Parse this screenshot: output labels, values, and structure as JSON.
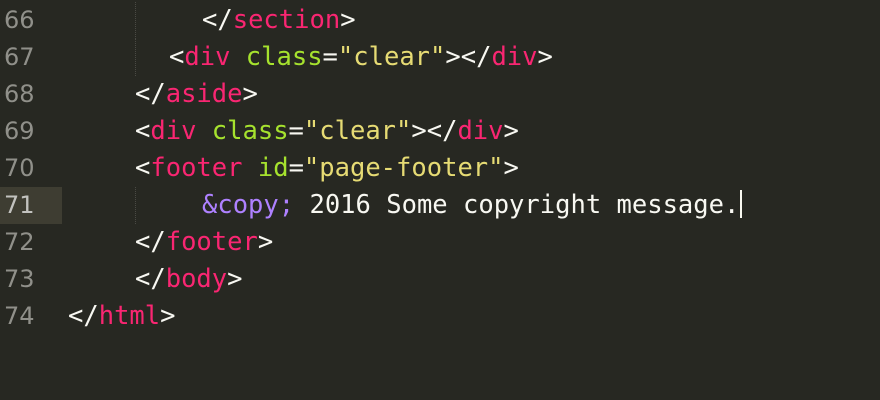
{
  "editor": {
    "theme_colors": {
      "background": "#272822",
      "line_number": "#90908a",
      "active_line_gutter": "#3e3d32",
      "tag": "#f92672",
      "attribute": "#a6e22e",
      "string": "#e6db74",
      "entity": "#ae81ff",
      "text": "#f8f8f2"
    },
    "active_line": "71",
    "lines": [
      {
        "number": "66",
        "open": "</",
        "tag": "section",
        "close": ">"
      },
      {
        "number": "67",
        "open": "<",
        "tag": "div",
        "attr": "class",
        "eq": "=",
        "value": "\"clear\"",
        "close": "></",
        "tag2": "div",
        "close2": ">"
      },
      {
        "number": "68",
        "open": "</",
        "tag": "aside",
        "close": ">"
      },
      {
        "number": "69",
        "open": "<",
        "tag": "div",
        "attr": "class",
        "eq": "=",
        "value": "\"clear\"",
        "close": "></",
        "tag2": "div",
        "close2": ">"
      },
      {
        "number": "70",
        "open": "<",
        "tag": "footer",
        "attr": "id",
        "eq": "=",
        "value": "\"page-footer\"",
        "close": ">"
      },
      {
        "number": "71",
        "entity": "&copy;",
        "text": " 2016 Some copyright message."
      },
      {
        "number": "72",
        "open": "</",
        "tag": "footer",
        "close": ">"
      },
      {
        "number": "73",
        "open": "</",
        "tag": "body",
        "close": ">"
      },
      {
        "number": "74",
        "open": "</",
        "tag": "html",
        "close": ">"
      }
    ]
  }
}
